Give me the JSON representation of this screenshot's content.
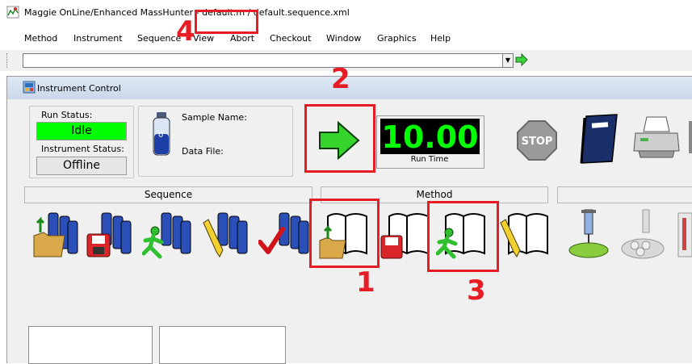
{
  "window": {
    "title": "Maggie OnLine/Enhanced MassHunter - default.m / default.sequence.xml"
  },
  "menu": [
    {
      "label": "Method"
    },
    {
      "label": "Instrument"
    },
    {
      "label": "Sequence"
    },
    {
      "label": "View"
    },
    {
      "label": "Abort"
    },
    {
      "label": "Checkout"
    },
    {
      "label": "Window"
    },
    {
      "label": "Graphics"
    },
    {
      "label": "Help"
    }
  ],
  "address": {
    "value": ""
  },
  "instrument_control": {
    "title": "Instrument Control",
    "run_status_label": "Run Status:",
    "run_status_value": "Idle",
    "instrument_status_label": "Instrument Status:",
    "instrument_status_value": "Offline",
    "sample_name_label": "Sample Name:",
    "data_file_label": "Data File:",
    "vial_number": "0",
    "run_time_value": "10.00",
    "run_time_label": "Run Time",
    "stop_label": "STOP",
    "sections": {
      "sequence": "Sequence",
      "method": "Method"
    }
  },
  "annotations": {
    "n1": "1",
    "n2": "2",
    "n3": "3",
    "n4": "4"
  },
  "colors": {
    "annotation_red": "#e81c24",
    "idle_green": "#00ff00",
    "display_green": "#00ff00"
  }
}
